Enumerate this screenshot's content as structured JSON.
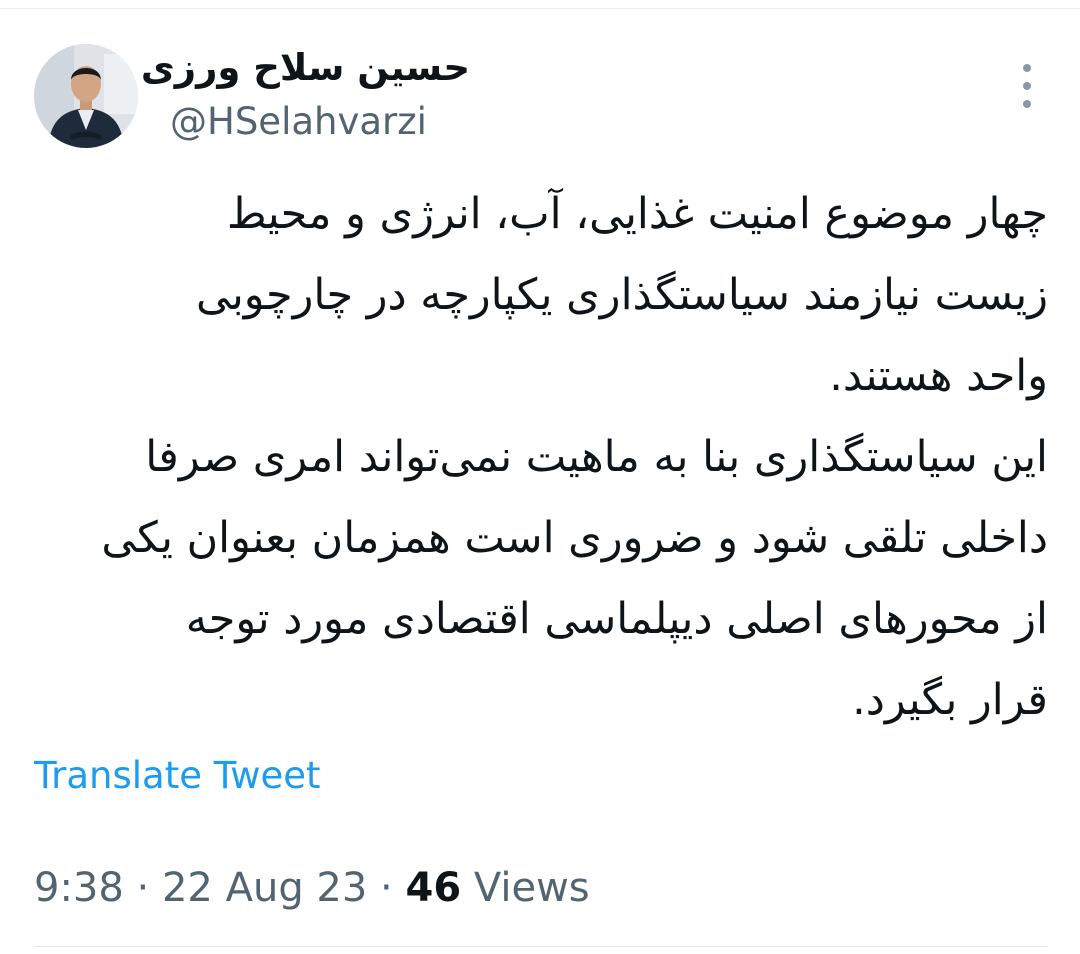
{
  "author": {
    "display_name": "حسین سلاح ورزی",
    "handle": "@HSelahvarzi"
  },
  "tweet": {
    "lines": [
      "چهار موضوع امنیت غذایی، آب، انرژی و محیط",
      "زیست نیازمند سیاستگذاری یکپارچه در چارچوبی",
      "واحد هستند.",
      "این سیاستگذاری بنا به ماهیت نمی‌تواند امری صرفا",
      "داخلی تلقی شود و ضروری است همزمان بعنوان یکی",
      "از محورهای اصلی دیپلماسی اقتصادی مورد توجه",
      "قرار بگیرد."
    ]
  },
  "translate_label": "Translate Tweet",
  "meta": {
    "time": "9:38",
    "separator": "·",
    "date": "22 Aug 23",
    "views_count": "46",
    "views_label": "Views"
  },
  "icons": {
    "more": "more-vertical-icon",
    "avatar": "avatar-photo"
  },
  "colors": {
    "text_primary": "#0f1419",
    "text_secondary": "#536471",
    "link": "#1d9bf0"
  }
}
